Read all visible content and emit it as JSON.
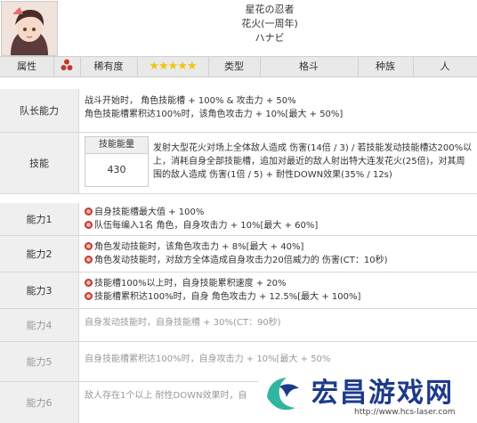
{
  "header": {
    "name_line1": "星花の忍者",
    "name_line2": "花火(一周年)",
    "name_line3": "ハナビ"
  },
  "attr_bar": {
    "attribute_label": "属性",
    "rarity_label": "稀有度",
    "rarity_stars": "★★★★★",
    "type_label": "类型",
    "type_value": "格斗",
    "race_label": "种族",
    "race_value": "人"
  },
  "leader": {
    "label": "队长能力",
    "line1": "战斗开始时， 角色技能槽 + 100% & 攻击力 + 50%",
    "line2": "角色技能槽累积达100%时，该角色攻击力 + 10%[最大 + 50%]"
  },
  "skill": {
    "label": "技能",
    "gauge_header": "技能能量",
    "gauge_value": "430",
    "desc1": "发射大型花火对场上全体敌人造成  伤害(14倍 / 3) / 若技能发动技能槽达200%以上，消耗自身全部技能槽，追加对最近的敌人射出特大连发花火(25倍)，对其周围的敌人造成  伤害(1倍 / 5) +  耐性DOWN效果(35% / 12s)"
  },
  "abilities": [
    {
      "label": "能力1",
      "lines": [
        "自身技能槽最大值 + 100%",
        "队伍每编入1名  角色，自身攻击力 + 10%[最大 + 60%]"
      ]
    },
    {
      "label": "能力2",
      "lines": [
        "角色发动技能时，该角色攻击力 + 8%[最大 + 40%]",
        "角色发动技能时，对敌方全体造成自身攻击力20倍威力的  伤害(CT：10秒)"
      ]
    },
    {
      "label": "能力3",
      "lines": [
        "技能槽100%以上时，自身技能累积速度 + 20%",
        "技能槽累积达100%时，自身  角色攻击力 + 12.5%[最大 + 100%]"
      ]
    },
    {
      "label": "能力4",
      "lines": [
        "自身发动技能时，自身技能槽 + 30%(CT：90秒)"
      ]
    },
    {
      "label": "能力5",
      "lines": [
        "自身技能槽累积达100%时，自身攻击力 + 10%[最大 + 50%"
      ]
    },
    {
      "label": "能力6",
      "lines": [
        "敌人存在1个以上  耐性DOWN效果时，自"
      ]
    }
  ],
  "watermark": {
    "title": "宏昌游戏网",
    "url": "http://www.hcs-laser.com"
  },
  "colors": {
    "label_bg": "#efefef",
    "bar_bg": "#e9e9e9",
    "fire_icon": "#c0392b",
    "stars": "#f1c40f",
    "watermark_text": "#1e3a8a"
  }
}
